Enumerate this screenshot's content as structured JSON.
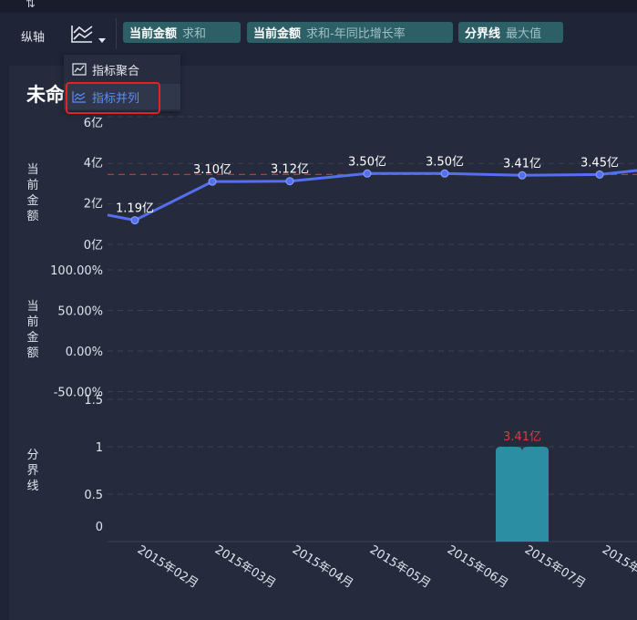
{
  "toolbar": {
    "sort_glyph": "⇅",
    "axis_label": "纵轴",
    "fields": [
      {
        "name": "当前金额",
        "agg": "求和"
      },
      {
        "name": "当前金额",
        "agg": "求和-年同比增长率"
      },
      {
        "name": "分界线",
        "agg": "最大值"
      }
    ]
  },
  "menu": {
    "items": [
      {
        "label": "指标聚合",
        "icon": "area-chart-icon"
      },
      {
        "label": "指标并列",
        "icon": "parallel-lines-icon",
        "active": true
      }
    ]
  },
  "title": "未命",
  "colors": {
    "line": "#5470f0",
    "threshold": "#d03030",
    "bar": "#2b8ea3",
    "bar_label": "#e03a3a",
    "accent": "#5a8cff",
    "pill": "#2d5f66"
  },
  "chart_data": [
    {
      "type": "line",
      "ylabel": "当前金额",
      "yticks": [
        "6亿",
        "4亿",
        "2亿",
        "0亿"
      ],
      "ytick_values": [
        6,
        4,
        2,
        0
      ],
      "values": [
        1.45,
        1.19,
        3.1,
        3.12,
        3.5,
        3.5,
        3.41,
        3.45,
        3.65
      ],
      "labels": [
        "",
        "1.19亿",
        "3.10亿",
        "3.12亿",
        "3.50亿",
        "3.50亿",
        "3.41亿",
        "3.45亿",
        ""
      ],
      "threshold": 3.45,
      "unit": "亿"
    },
    {
      "type": "line",
      "ylabel": "当前金额",
      "yticks": [
        "100.00%",
        "50.00%",
        "0.00%",
        "-50.00%"
      ],
      "ytick_values": [
        100,
        50,
        0,
        -50
      ],
      "values": []
    },
    {
      "type": "bar",
      "ylabel": "分界线",
      "yticks": [
        "1.5",
        "1",
        "0.5",
        "0"
      ],
      "ytick_values": [
        1.5,
        1,
        0.5,
        0
      ],
      "categories": [
        "2015年02月",
        "2015年03月",
        "2015年04月",
        "2015年05月",
        "2015年06月",
        "2015年07月",
        "2015年"
      ],
      "values": [
        null,
        null,
        null,
        null,
        null,
        1,
        null
      ],
      "labels": [
        "",
        "",
        "",
        "",
        "",
        "3.41亿",
        ""
      ]
    }
  ]
}
